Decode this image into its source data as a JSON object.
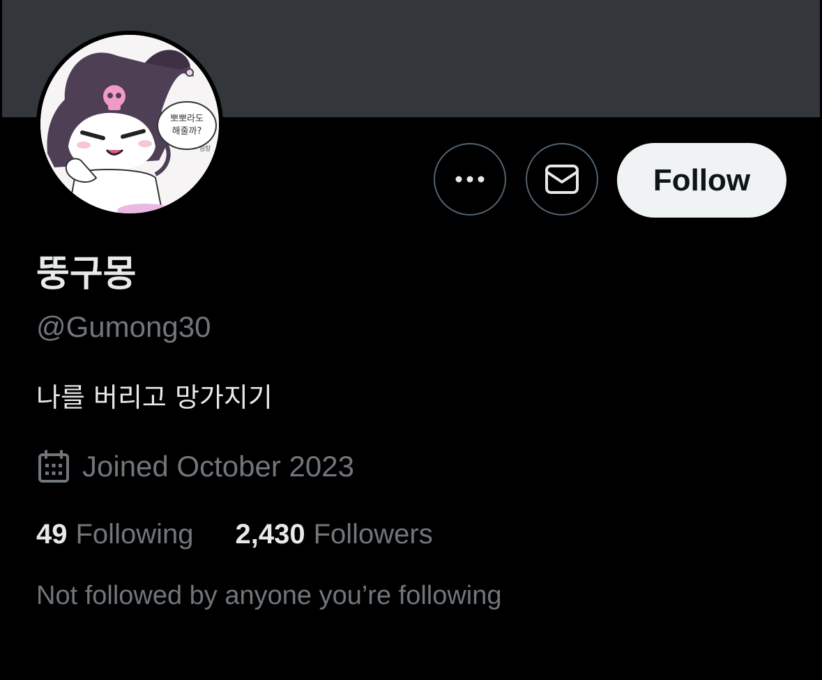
{
  "profile": {
    "display_name": "뚱구몽",
    "handle": "@Gumong30",
    "bio": "나를 버리고 망가지기",
    "joined": "Joined October 2023",
    "avatar_speech": [
      "뽀뽀라도",
      "해줄까?"
    ],
    "avatar_signature": "님랑"
  },
  "stats": {
    "following_count": "49",
    "following_label": "Following",
    "followers_count": "2,430",
    "followers_label": "Followers"
  },
  "social_context": "Not followed by anyone you’re following",
  "actions": {
    "follow_label": "Follow",
    "more_icon": "more-horizontal-icon",
    "message_icon": "envelope-icon"
  },
  "colors": {
    "background": "#000000",
    "banner": "#33363a",
    "primary_text": "#e7e9ea",
    "secondary_text": "#71767b",
    "button_border": "#536471",
    "follow_bg": "#eff3f4",
    "follow_text": "#0f1419"
  }
}
